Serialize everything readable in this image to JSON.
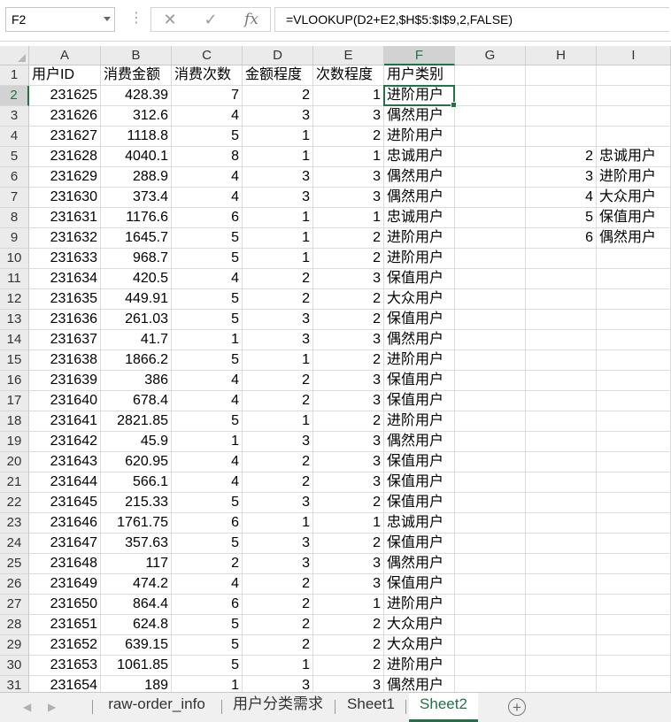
{
  "formula_bar": {
    "name_box": "F2",
    "cancel_icon": "✕",
    "enter_icon": "✓",
    "fx_label": "fx",
    "formula": "=VLOOKUP(D2+E2,$H$5:$I$9,2,FALSE)"
  },
  "columns": [
    "A",
    "B",
    "C",
    "D",
    "E",
    "F",
    "G",
    "H",
    "I"
  ],
  "selected_cell": "F2",
  "header_row": [
    "用户ID",
    "消费金额",
    "消费次数",
    "金额程度",
    "次数程度",
    "用户类别"
  ],
  "rows": [
    [
      "231625",
      "428.39",
      "7",
      "2",
      "1",
      "进阶用户"
    ],
    [
      "231626",
      "312.6",
      "4",
      "3",
      "3",
      "偶然用户"
    ],
    [
      "231627",
      "1118.8",
      "5",
      "1",
      "2",
      "进阶用户"
    ],
    [
      "231628",
      "4040.1",
      "8",
      "1",
      "1",
      "忠诚用户"
    ],
    [
      "231629",
      "288.9",
      "4",
      "3",
      "3",
      "偶然用户"
    ],
    [
      "231630",
      "373.4",
      "4",
      "3",
      "3",
      "偶然用户"
    ],
    [
      "231631",
      "1176.6",
      "6",
      "1",
      "1",
      "忠诚用户"
    ],
    [
      "231632",
      "1645.7",
      "5",
      "1",
      "2",
      "进阶用户"
    ],
    [
      "231633",
      "968.7",
      "5",
      "1",
      "2",
      "进阶用户"
    ],
    [
      "231634",
      "420.5",
      "4",
      "2",
      "3",
      "保值用户"
    ],
    [
      "231635",
      "449.91",
      "5",
      "2",
      "2",
      "大众用户"
    ],
    [
      "231636",
      "261.03",
      "5",
      "3",
      "2",
      "保值用户"
    ],
    [
      "231637",
      "41.7",
      "1",
      "3",
      "3",
      "偶然用户"
    ],
    [
      "231638",
      "1866.2",
      "5",
      "1",
      "2",
      "进阶用户"
    ],
    [
      "231639",
      "386",
      "4",
      "2",
      "3",
      "保值用户"
    ],
    [
      "231640",
      "678.4",
      "4",
      "2",
      "3",
      "保值用户"
    ],
    [
      "231641",
      "2821.85",
      "5",
      "1",
      "2",
      "进阶用户"
    ],
    [
      "231642",
      "45.9",
      "1",
      "3",
      "3",
      "偶然用户"
    ],
    [
      "231643",
      "620.95",
      "4",
      "2",
      "3",
      "保值用户"
    ],
    [
      "231644",
      "566.1",
      "4",
      "2",
      "3",
      "保值用户"
    ],
    [
      "231645",
      "215.33",
      "5",
      "3",
      "2",
      "保值用户"
    ],
    [
      "231646",
      "1761.75",
      "6",
      "1",
      "1",
      "忠诚用户"
    ],
    [
      "231647",
      "357.63",
      "5",
      "3",
      "2",
      "保值用户"
    ],
    [
      "231648",
      "117",
      "2",
      "3",
      "3",
      "偶然用户"
    ],
    [
      "231649",
      "474.2",
      "4",
      "2",
      "3",
      "保值用户"
    ],
    [
      "231650",
      "864.4",
      "6",
      "2",
      "1",
      "进阶用户"
    ],
    [
      "231651",
      "624.8",
      "5",
      "2",
      "2",
      "大众用户"
    ],
    [
      "231652",
      "639.15",
      "5",
      "2",
      "2",
      "大众用户"
    ],
    [
      "231653",
      "1061.85",
      "5",
      "1",
      "2",
      "进阶用户"
    ],
    [
      "231654",
      "189",
      "1",
      "3",
      "3",
      "偶然用户"
    ]
  ],
  "lookup_table": [
    {
      "row": 5,
      "key": "2",
      "label": "忠诚用户"
    },
    {
      "row": 6,
      "key": "3",
      "label": "进阶用户"
    },
    {
      "row": 7,
      "key": "4",
      "label": "大众用户"
    },
    {
      "row": 8,
      "key": "5",
      "label": "保值用户"
    },
    {
      "row": 9,
      "key": "6",
      "label": "偶然用户"
    }
  ],
  "sheet_tabs": [
    {
      "label": "raw-order_info",
      "active": false
    },
    {
      "label": "用户分类需求",
      "active": false
    },
    {
      "label": "Sheet1",
      "active": false
    },
    {
      "label": "Sheet2",
      "active": true
    }
  ],
  "tab_nav": {
    "prev_icon": "◀",
    "next_icon": "▶",
    "add_icon": "+"
  },
  "colors": {
    "accent": "#217346",
    "header_bg": "#ebebeb",
    "grid_line": "#dcdcdc"
  }
}
